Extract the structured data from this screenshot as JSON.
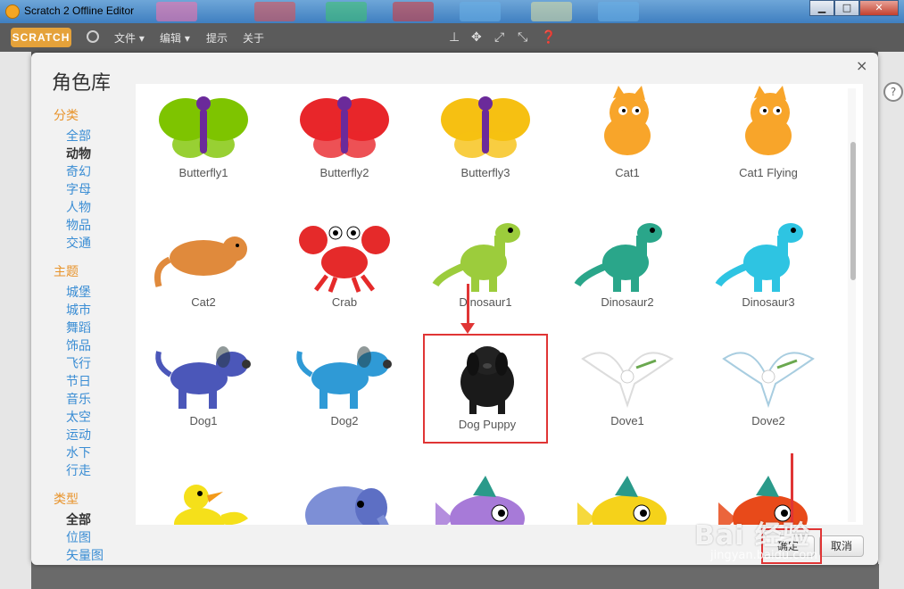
{
  "window": {
    "title": "Scratch 2 Offline Editor"
  },
  "menubar": {
    "items": [
      "文件 ▾",
      "编辑 ▾",
      "提示",
      "关于"
    ],
    "logo": "SCRATCH"
  },
  "help_glyph": "?",
  "dialog": {
    "title": "角色库",
    "close": "×",
    "sections": [
      {
        "title": "分类",
        "items": [
          "全部",
          "动物",
          "奇幻",
          "字母",
          "人物",
          "物品",
          "交通"
        ],
        "active": 1
      },
      {
        "title": "主题",
        "items": [
          "城堡",
          "城市",
          "舞蹈",
          "饰品",
          "飞行",
          "节日",
          "音乐",
          "太空",
          "运动",
          "水下",
          "行走"
        ],
        "active": -1
      },
      {
        "title": "类型",
        "items": [
          "全部",
          "位图",
          "矢量图"
        ],
        "active": 0
      }
    ],
    "sprites": [
      {
        "name": "Butterfly1",
        "icon": "butterfly-icon",
        "color": "#7ec400"
      },
      {
        "name": "Butterfly2",
        "icon": "butterfly-icon",
        "color": "#e8262a"
      },
      {
        "name": "Butterfly3",
        "icon": "butterfly-icon",
        "color": "#f6c012"
      },
      {
        "name": "Cat1",
        "icon": "cat-icon",
        "color": "#f8a52a"
      },
      {
        "name": "Cat1 Flying",
        "icon": "cat-icon",
        "color": "#f8a52a"
      },
      {
        "name": "Cat2",
        "icon": "hamster-icon",
        "color": "#e08a3c"
      },
      {
        "name": "Crab",
        "icon": "crab-icon",
        "color": "#e52a2a"
      },
      {
        "name": "Dinosaur1",
        "icon": "dinosaur-icon",
        "color": "#9ccc3c"
      },
      {
        "name": "Dinosaur2",
        "icon": "dinosaur-icon",
        "color": "#2aa68a"
      },
      {
        "name": "Dinosaur3",
        "icon": "dinosaur-icon",
        "color": "#2ec4e2"
      },
      {
        "name": "Dog1",
        "icon": "dog-icon",
        "color": "#4b57b9"
      },
      {
        "name": "Dog2",
        "icon": "dog-icon",
        "color": "#2f9ad6"
      },
      {
        "name": "Dog Puppy",
        "icon": "puppy-photo-icon",
        "color": "#222222"
      },
      {
        "name": "Dove1",
        "icon": "dove-icon",
        "color": "#dcdcdc"
      },
      {
        "name": "Dove2",
        "icon": "dove-icon",
        "color": "#a8cde0"
      },
      {
        "name": "",
        "icon": "duck-icon",
        "color": "#f5e01a"
      },
      {
        "name": "",
        "icon": "elephant-icon",
        "color": "#7d8fd6"
      },
      {
        "name": "",
        "icon": "fish-icon",
        "color": "#a77ad8"
      },
      {
        "name": "",
        "icon": "fish-icon",
        "color": "#f5d21a"
      },
      {
        "name": "",
        "icon": "fish-icon",
        "color": "#e84a1a"
      }
    ],
    "selected": 12,
    "ok_label": "确定",
    "cancel_label": "取消"
  },
  "watermark": {
    "main": "Bai 经验",
    "sub": "jingyan.baidu.com"
  },
  "colors": {
    "accent": "#e8932a",
    "link": "#3a8dd4",
    "annotation": "#e03535"
  }
}
